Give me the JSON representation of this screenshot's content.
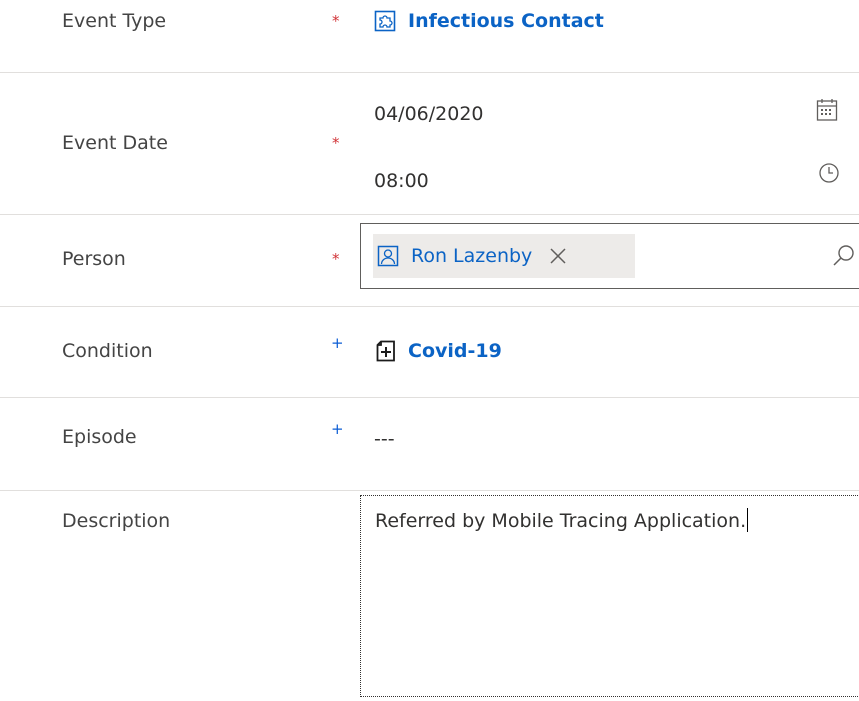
{
  "form": {
    "event_type": {
      "label": "Event Type",
      "required_mark": "*",
      "value": "Infectious Contact",
      "icon": "entity-puzzle-icon"
    },
    "event_date": {
      "label": "Event Date",
      "required_mark": "*",
      "date": "04/06/2020",
      "time": "08:00",
      "date_icon": "calendar-icon",
      "time_icon": "clock-icon"
    },
    "person": {
      "label": "Person",
      "required_mark": "*",
      "value": "Ron Lazenby",
      "tag_icon": "contact-icon",
      "remove_icon": "close-icon",
      "search_icon": "search-icon"
    },
    "condition": {
      "label": "Condition",
      "required_mark": "+",
      "value": "Covid-19",
      "icon": "medical-document-icon"
    },
    "episode": {
      "label": "Episode",
      "required_mark": "+",
      "value": "---"
    },
    "description": {
      "label": "Description",
      "value": "Referred by Mobile Tracing Application."
    }
  },
  "colors": {
    "link": "#0b63c5",
    "required": "#d13438",
    "recommended": "#0b5cd4",
    "divider": "#e1dfdd",
    "tag_bg": "#edebe9"
  }
}
